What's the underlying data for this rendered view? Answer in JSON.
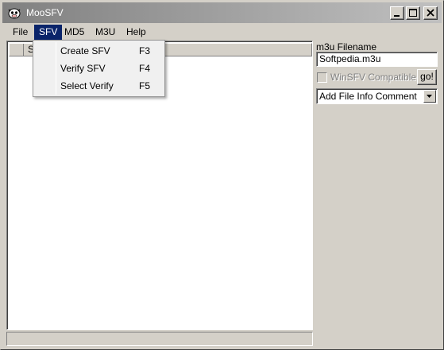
{
  "window": {
    "title": "MooSFV"
  },
  "menubar": {
    "items": [
      "File",
      "SFV",
      "MD5",
      "M3U",
      "Help"
    ]
  },
  "sfv_menu": {
    "items": [
      {
        "label": "Create SFV",
        "shortcut": "F3"
      },
      {
        "label": "Verify SFV",
        "shortcut": "F4"
      },
      {
        "label": "Select Verify",
        "shortcut": "F5"
      }
    ]
  },
  "listview": {
    "header_partial": "S"
  },
  "right_panel": {
    "m3u_label": "m3u Filename",
    "m3u_value": "Softpedia.m3u",
    "winsfv_label": "WinSFV Compatible",
    "winsfv_checked": false,
    "go_label": "go!",
    "comment_selected": "Add File Info Comment"
  },
  "status": {
    "text": ""
  }
}
